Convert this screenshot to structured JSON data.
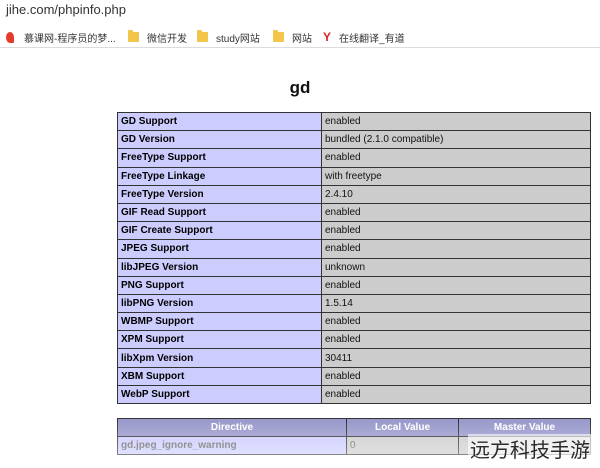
{
  "address_bar": {
    "url": "jihe.com/phpinfo.php"
  },
  "bookmarks": [
    {
      "label": "慕课网-程序员的梦...",
      "icon": "site-logo-icon"
    },
    {
      "label": "微信开发",
      "icon": "folder-icon"
    },
    {
      "label": "study网站",
      "icon": "folder-icon"
    },
    {
      "label": "网站",
      "icon": "folder-icon"
    },
    {
      "label": "在线翻译_有道",
      "icon": "youdao-icon",
      "icon_glyph": "Y"
    }
  ],
  "section": {
    "title": "gd",
    "rows": [
      {
        "name": "GD Support",
        "value": "enabled"
      },
      {
        "name": "GD Version",
        "value": "bundled (2.1.0 compatible)"
      },
      {
        "name": "FreeType Support",
        "value": "enabled"
      },
      {
        "name": "FreeType Linkage",
        "value": "with freetype"
      },
      {
        "name": "FreeType Version",
        "value": "2.4.10"
      },
      {
        "name": "GIF Read Support",
        "value": "enabled"
      },
      {
        "name": "GIF Create Support",
        "value": "enabled"
      },
      {
        "name": "JPEG Support",
        "value": "enabled"
      },
      {
        "name": "libJPEG Version",
        "value": "unknown"
      },
      {
        "name": "PNG Support",
        "value": "enabled"
      },
      {
        "name": "libPNG Version",
        "value": "1.5.14"
      },
      {
        "name": "WBMP Support",
        "value": "enabled"
      },
      {
        "name": "XPM Support",
        "value": "enabled"
      },
      {
        "name": "libXpm Version",
        "value": "30411"
      },
      {
        "name": "XBM Support",
        "value": "enabled"
      },
      {
        "name": "WebP Support",
        "value": "enabled"
      }
    ]
  },
  "directives": {
    "headers": [
      "Directive",
      "Local Value",
      "Master Value"
    ],
    "rows": [
      {
        "directive": "gd.jpeg_ignore_warning",
        "local": "0",
        "master": ""
      }
    ]
  },
  "watermark": "远方科技手游",
  "colors": {
    "name_cell": "#ccccff",
    "value_cell": "#cccccc",
    "header_cell": "#9999cc"
  }
}
